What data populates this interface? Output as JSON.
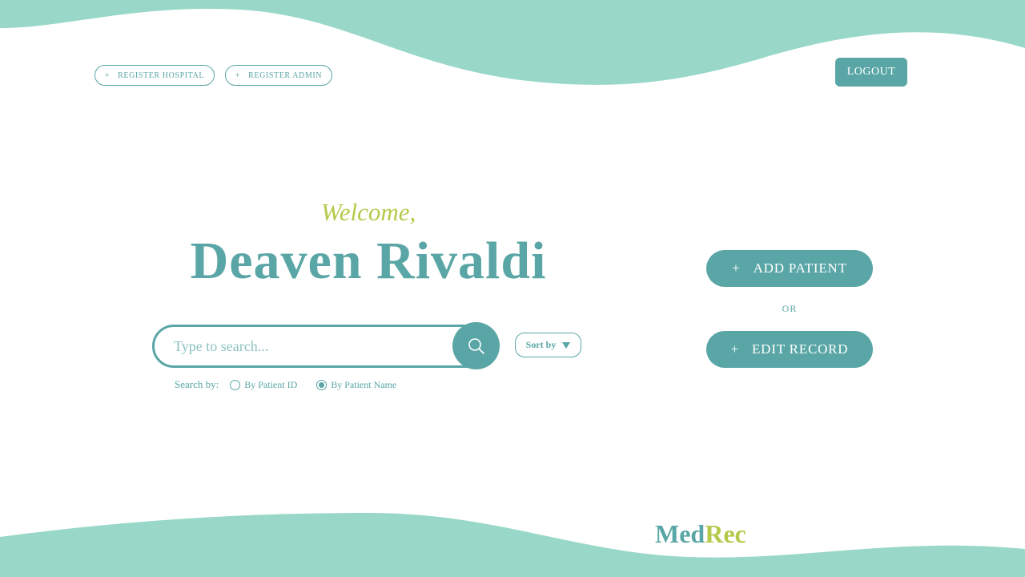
{
  "header": {
    "register_hospital": "REGISTER HOSPITAL",
    "register_admin": "REGISTER ADMIN",
    "logout": "LOGOUT",
    "plus": "+"
  },
  "greeting": {
    "welcome": "Welcome,",
    "user_name": "Deaven Rivaldi"
  },
  "search": {
    "placeholder": "Type to search...",
    "value": "",
    "sort_label": "Sort by",
    "search_by_label": "Search by:",
    "options": [
      {
        "label": "By Patient ID",
        "checked": false
      },
      {
        "label": "By Patient Name",
        "checked": true
      }
    ]
  },
  "actions": {
    "add_patient": "ADD PATIENT",
    "or": "OR",
    "edit_record": "EDIT RECORD"
  },
  "logo": {
    "part1": "Med",
    "part2": "Rec"
  },
  "colors": {
    "primary": "#5aa6a6",
    "accent": "#b5c94a",
    "wave": "#99d8c9"
  }
}
